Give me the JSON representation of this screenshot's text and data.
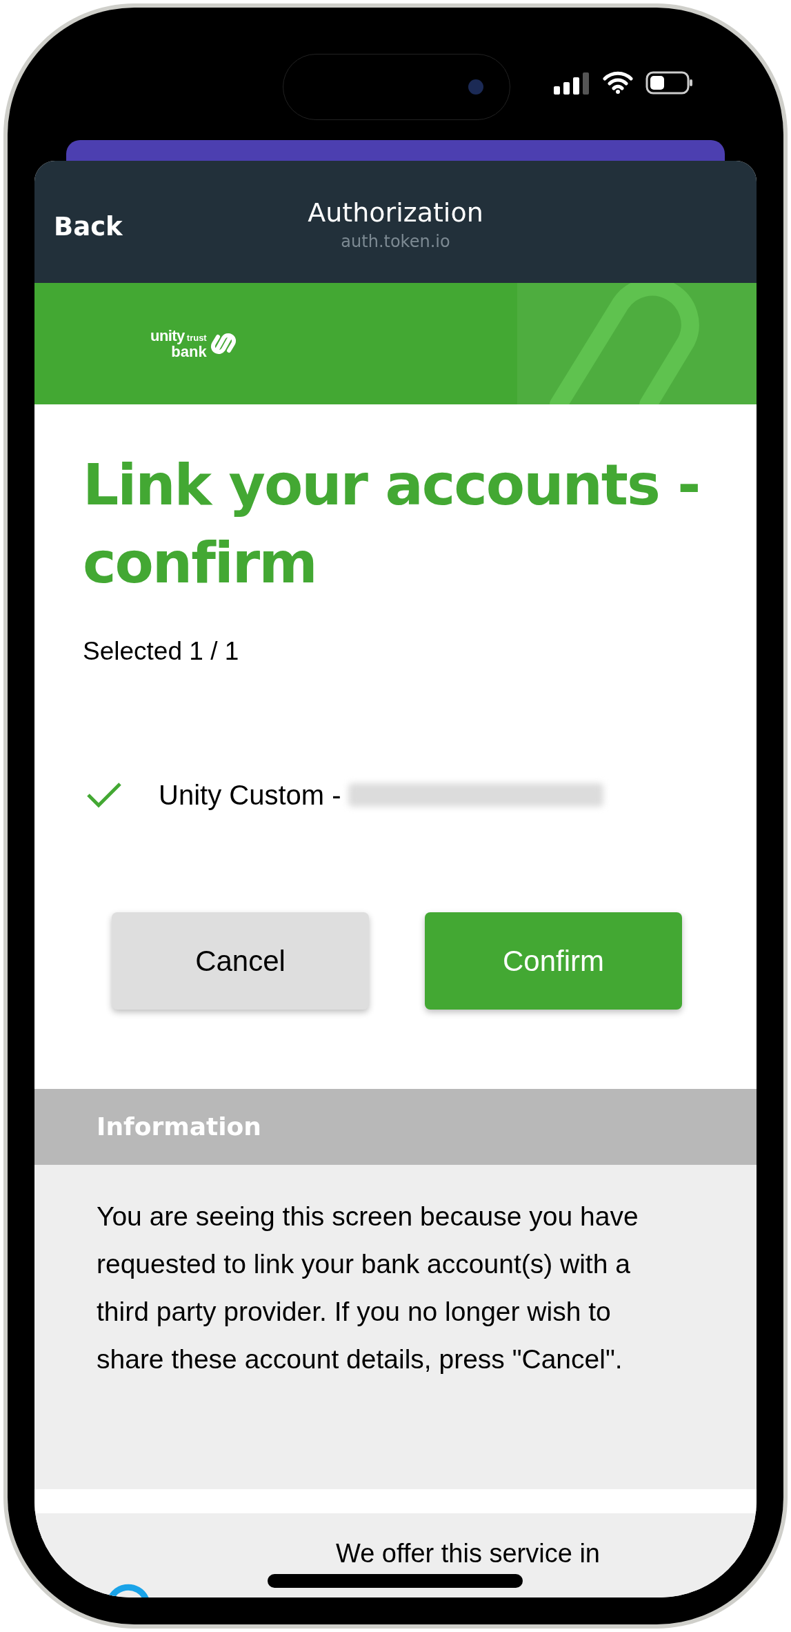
{
  "header": {
    "back": "Back",
    "title": "Authorization",
    "subtitle": "auth.token.io"
  },
  "bank_logo": {
    "word_1": "unity",
    "word_2": "trust",
    "word_3": "bank"
  },
  "title": "Link your accounts - confirm",
  "selection_count": "Selected 1 / 1",
  "accounts": [
    {
      "label": "Unity Custom -",
      "checked": true
    }
  ],
  "buttons": [
    {
      "label": "Cancel",
      "kind": "secondary"
    },
    {
      "label": "Confirm",
      "kind": "primary"
    }
  ],
  "information": {
    "heading": "Information",
    "body": "You are seeing this screen because you have requested to link your bank account(s) with a third party provider. If you no longer wish to share these account details, press \"Cancel\"."
  },
  "footer": {
    "text": "We offer this service in"
  }
}
